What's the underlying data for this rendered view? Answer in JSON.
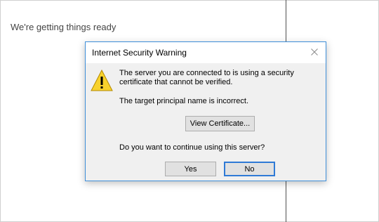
{
  "background": {
    "status_text": "We're getting things ready"
  },
  "dialog": {
    "title": "Internet Security Warning",
    "message": "The server you are connected to is using a security certificate that cannot be verified.",
    "principal_message": "The target principal name is incorrect.",
    "view_certificate_label": "View Certificate...",
    "question": "Do you want to continue using this server?",
    "yes_label": "Yes",
    "no_label": "No",
    "close_icon": "close-icon",
    "warning_icon": "warning-icon"
  },
  "colors": {
    "dialog_border": "#3f8fd9",
    "default_button_border": "#2f7ad6",
    "warning_yellow": "#f8d22c"
  }
}
